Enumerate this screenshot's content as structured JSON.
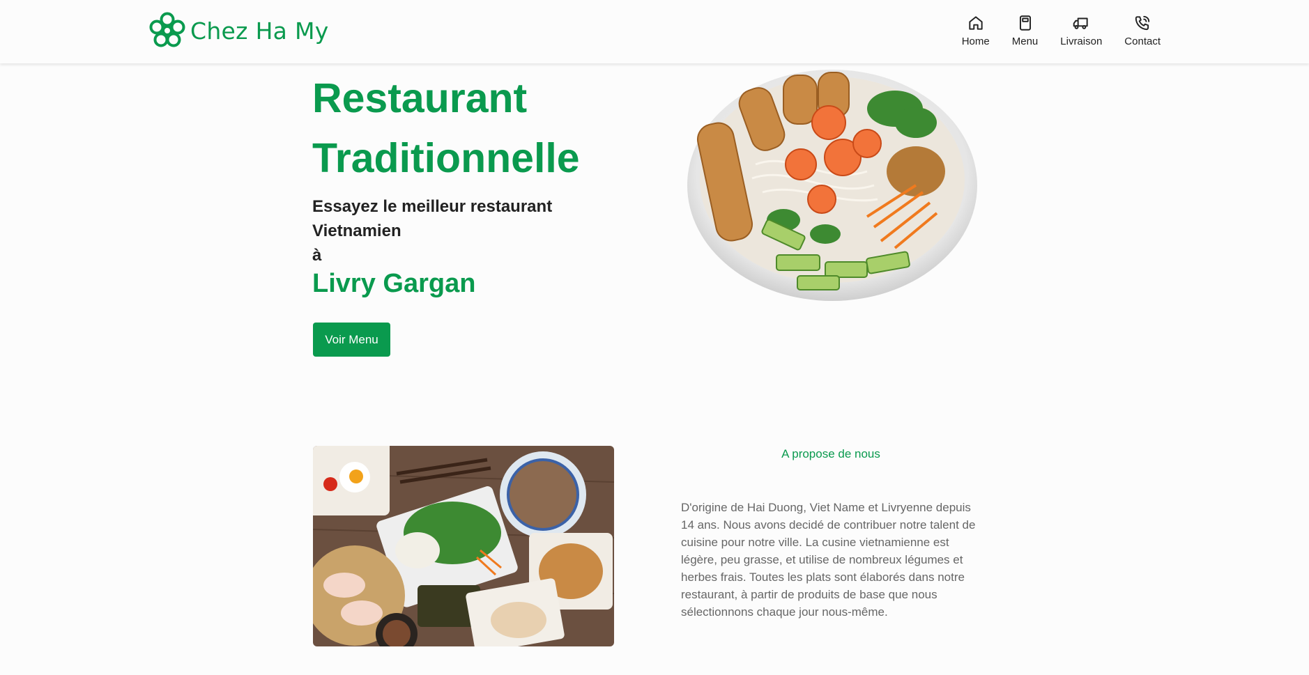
{
  "header": {
    "brand": "Chez Ha My",
    "nav": [
      {
        "label": "Home",
        "icon": "home-icon"
      },
      {
        "label": "Menu",
        "icon": "book-icon"
      },
      {
        "label": "Livraison",
        "icon": "truck-icon"
      },
      {
        "label": "Contact",
        "icon": "phone-icon"
      }
    ]
  },
  "hero": {
    "title_line1": "Restaurant",
    "title_line2": "Traditionnelle",
    "subtitle_line1": "Essayez le meilleur restaurant",
    "subtitle_line2": "Vietnamien",
    "subtitle_line3": "à",
    "city": "Livry Gargan",
    "cta_label": "Voir Menu",
    "image": "noodle-bowl-photo"
  },
  "about": {
    "kicker": "A propose de nous",
    "body": "D'origine de Hai Duong, Viet Name et Livryenne depuis 14 ans. Nous avons decidé de contribuer notre talent de cuisine pour notre ville. La cusine vietnamienne est légère, peu grasse, et utilise de nombreux légumes et herbes frais. Toutes les plats sont élaborés dans notre restaurant, à partir de produits de base que nous sélectionnons chaque jour nous-même.",
    "image": "vietnamese-dishes-photo"
  },
  "colors": {
    "brand": "#0a9a4e",
    "text": "#222222",
    "muted": "#666666",
    "background": "#fcfcfc"
  }
}
